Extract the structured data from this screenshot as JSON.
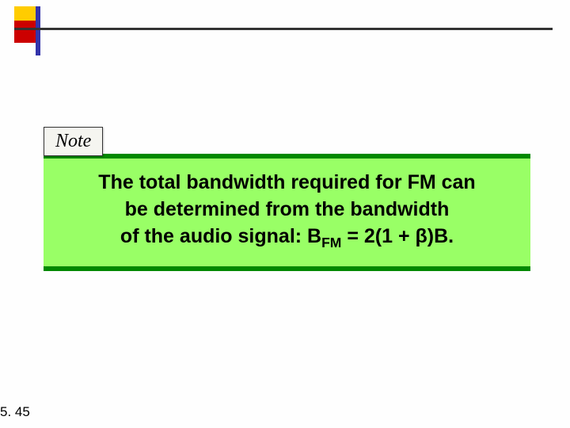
{
  "note_label": "Note",
  "content": {
    "line1": "The total bandwidth required for FM can",
    "line2": "be determined from the bandwidth",
    "line3_prefix": "of the audio signal: B",
    "line3_sub": "FM",
    "line3_suffix": " = 2(1 + β)B."
  },
  "page_number": "5. 45"
}
